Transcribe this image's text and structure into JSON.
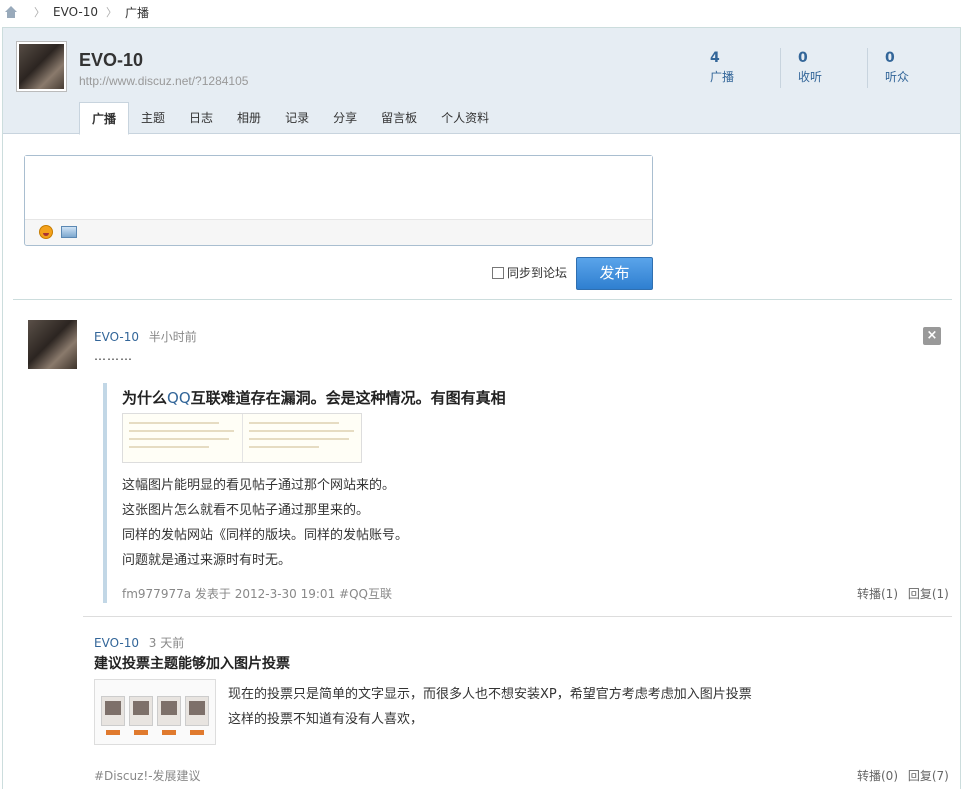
{
  "breadcrumb": {
    "user": "EVO-10",
    "section": "广播"
  },
  "profile": {
    "name": "EVO-10",
    "url": "http://www.discuz.net/?1284105",
    "stats": [
      {
        "num": "4",
        "label": "广播"
      },
      {
        "num": "0",
        "label": "收听"
      },
      {
        "num": "0",
        "label": "听众"
      }
    ]
  },
  "tabs": [
    "广播",
    "主题",
    "日志",
    "相册",
    "记录",
    "分享",
    "留言板",
    "个人资料"
  ],
  "composer": {
    "sync_label": "同步到论坛",
    "publish_label": "发布"
  },
  "posts": [
    {
      "author": "EVO-10",
      "time": "半小时前",
      "text": "………",
      "quote": {
        "title_pre": "为什么",
        "title_hl": "QQ",
        "title_post": "互联难道存在漏洞。会是这种情况。有图有真相",
        "lines": [
          "这幅图片能明显的看见帖子通过那个网站来的。",
          "这张图片怎么就看不见帖子通过那里来的。",
          "同样的发帖网站《同样的版块。同样的发帖账号。",
          "问题就是通过来源时有时无。"
        ],
        "footer": "fm977977a 发表于 2012-3-30 19:01 #QQ互联"
      },
      "forward": "转播(1)",
      "reply": "回复(1)"
    },
    {
      "author": "EVO-10",
      "time": "3 天前",
      "title": "建议投票主题能够加入图片投票",
      "lines": [
        "现在的投票只是简单的文字显示，而很多人也不想安装XP，希望官方考虑考虑加入图片投票",
        "这样的投票不知道有没有人喜欢，"
      ],
      "footer": "#Discuz!-发展建议",
      "forward": "转播(0)",
      "reply": "回复(7)"
    }
  ]
}
